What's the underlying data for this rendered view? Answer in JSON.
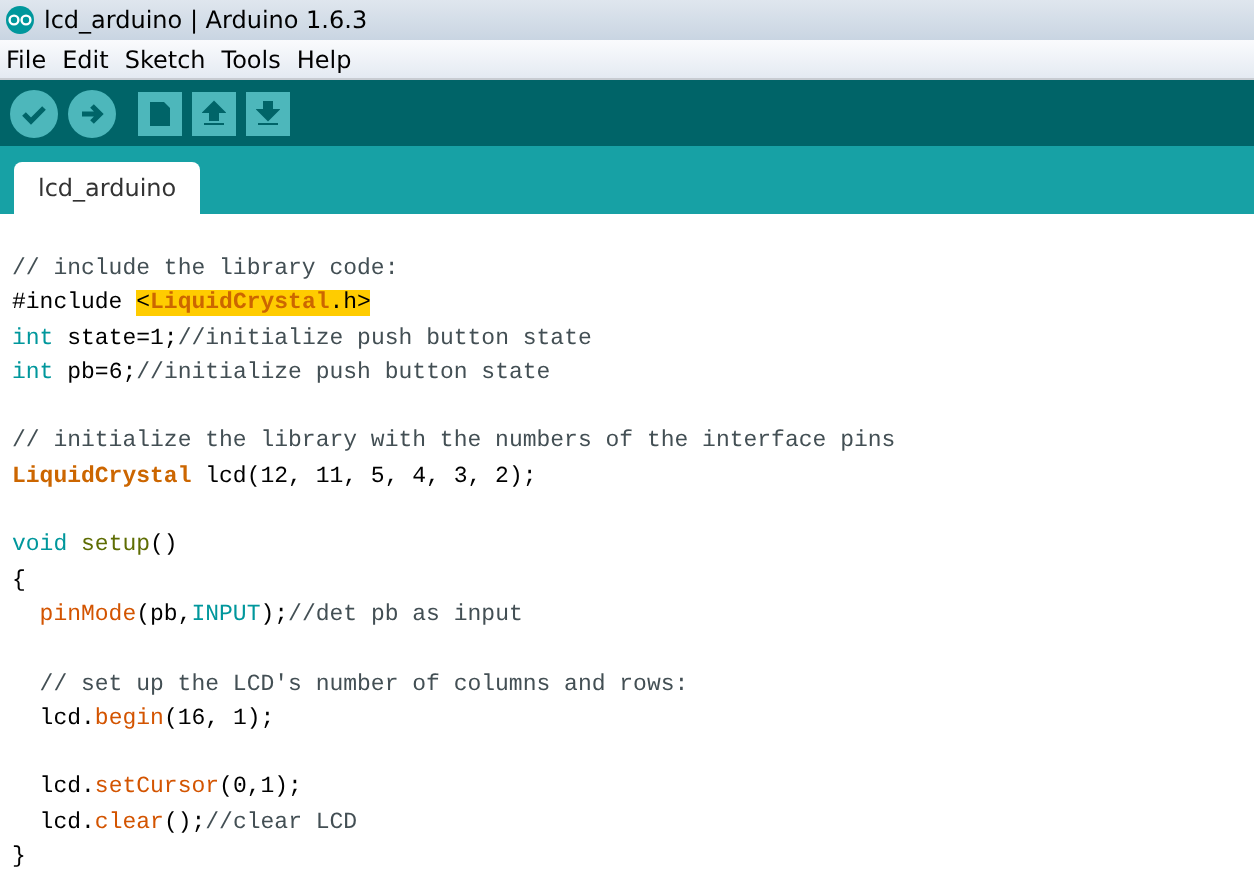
{
  "window": {
    "title": "lcd_arduino | Arduino 1.6.3"
  },
  "menu": [
    "File",
    "Edit",
    "Sketch",
    "Tools",
    "Help"
  ],
  "toolbar": [
    {
      "kind": "verify"
    },
    {
      "kind": "upload"
    },
    {
      "kind": "new"
    },
    {
      "kind": "open"
    },
    {
      "kind": "save"
    }
  ],
  "tabs": [
    {
      "label": "lcd_arduino",
      "selected": true
    }
  ],
  "code": [
    {
      "kind": "code",
      "tokens": [
        {
          "kind": "comment",
          "text": "// include the library code:"
        }
      ]
    },
    {
      "kind": "code",
      "tokens": [
        {
          "kind": "plain",
          "text": "#include "
        },
        {
          "kind": "match",
          "text": "<"
        },
        {
          "kind": "matchclass",
          "text": "LiquidCrystal"
        },
        {
          "kind": "match",
          "text": ".h>"
        }
      ]
    },
    {
      "kind": "code",
      "tokens": [
        {
          "kind": "keyword",
          "text": "int"
        },
        {
          "kind": "plain",
          "text": " state=1;"
        },
        {
          "kind": "comment",
          "text": "//initialize push button state"
        }
      ]
    },
    {
      "kind": "code",
      "tokens": [
        {
          "kind": "keyword",
          "text": "int"
        },
        {
          "kind": "plain",
          "text": " pb=6;"
        },
        {
          "kind": "comment",
          "text": "//initialize push button state"
        }
      ]
    },
    {
      "kind": "blank"
    },
    {
      "kind": "code",
      "tokens": [
        {
          "kind": "comment",
          "text": "// initialize the library with the numbers of the interface pins"
        }
      ]
    },
    {
      "kind": "code",
      "tokens": [
        {
          "kind": "class",
          "text": "LiquidCrystal"
        },
        {
          "kind": "plain",
          "text": " lcd(12, 11, 5, 4, 3, 2);"
        }
      ]
    },
    {
      "kind": "blank"
    },
    {
      "kind": "code",
      "tokens": [
        {
          "kind": "keyword",
          "text": "void"
        },
        {
          "kind": "setup",
          "text": " setup"
        },
        {
          "kind": "plain",
          "text": "()"
        }
      ]
    },
    {
      "kind": "code",
      "tokens": [
        {
          "kind": "plain",
          "text": "{"
        }
      ]
    },
    {
      "kind": "code",
      "indent": true,
      "tokens": [
        {
          "kind": "func",
          "text": "pinMode"
        },
        {
          "kind": "plain",
          "text": "(pb,"
        },
        {
          "kind": "keyword",
          "text": "INPUT"
        },
        {
          "kind": "plain",
          "text": ");"
        },
        {
          "kind": "comment",
          "text": "//det pb as input"
        }
      ]
    },
    {
      "kind": "blank"
    },
    {
      "kind": "code",
      "indent": true,
      "tokens": [
        {
          "kind": "comment",
          "text": "// set up the LCD's number of columns and rows:"
        }
      ]
    },
    {
      "kind": "code",
      "tokens": [
        {
          "kind": "plain",
          "text": "  lcd."
        },
        {
          "kind": "func",
          "text": "begin"
        },
        {
          "kind": "plain",
          "text": "(16, 1);"
        }
      ]
    },
    {
      "kind": "blank"
    },
    {
      "kind": "code",
      "tokens": [
        {
          "kind": "plain",
          "text": "  lcd."
        },
        {
          "kind": "func",
          "text": "setCursor"
        },
        {
          "kind": "plain",
          "text": "(0,1);"
        }
      ]
    },
    {
      "kind": "code",
      "tokens": [
        {
          "kind": "plain",
          "text": "  lcd."
        },
        {
          "kind": "func",
          "text": "clear"
        },
        {
          "kind": "plain",
          "text": "();"
        },
        {
          "kind": "comment",
          "text": "//clear LCD"
        }
      ]
    },
    {
      "kind": "code",
      "tokens": [
        {
          "kind": "plain",
          "text": "}"
        }
      ]
    }
  ]
}
